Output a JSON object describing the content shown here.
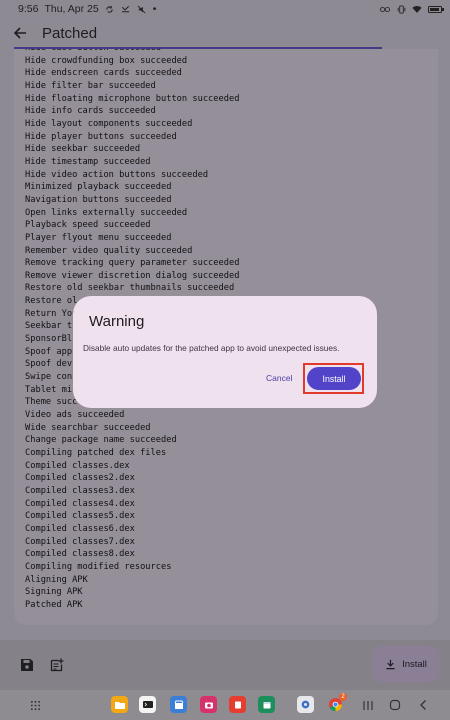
{
  "status_bar": {
    "time": "9:56",
    "date": "Thu, Apr 25",
    "dot": "•"
  },
  "app_bar": {
    "title": "Patched"
  },
  "log": {
    "lines": [
      "Hide cast button succeeded",
      "Hide crowdfunding box succeeded",
      "Hide endscreen cards succeeded",
      "Hide filter bar succeeded",
      "Hide floating microphone button succeeded",
      "Hide info cards succeeded",
      "Hide layout components succeeded",
      "Hide player buttons succeeded",
      "Hide seekbar succeeded",
      "Hide timestamp succeeded",
      "Hide video action buttons succeeded",
      "Minimized playback succeeded",
      "Navigation buttons succeeded",
      "Open links externally succeeded",
      "Playback speed succeeded",
      "Player flyout menu succeeded",
      "Remember video quality succeeded",
      "Remove tracking query parameter succeeded",
      "Remove viewer discretion dialog succeeded",
      "Restore old seekbar thumbnails succeeded",
      "Restore ol",
      "Return You",
      "Seekbar t",
      "SponsorBl",
      "Spoof app",
      "Spoof dev",
      "Swipe con",
      "Tablet mi",
      "Theme succ",
      "Video ads succeeded",
      "Wide searchbar succeeded",
      "Change package name succeeded",
      "Compiling patched dex files",
      "Compiled classes.dex",
      "Compiled classes2.dex",
      "Compiled classes3.dex",
      "Compiled classes4.dex",
      "Compiled classes5.dex",
      "Compiled classes6.dex",
      "Compiled classes7.dex",
      "Compiled classes8.dex",
      "Compiling modified resources",
      "Aligning APK",
      "Signing APK",
      "Patched APK"
    ]
  },
  "bottom_bar": {
    "install_label": "Install"
  },
  "taskbar": {
    "chrome_badge": "2"
  },
  "dialog": {
    "title": "Warning",
    "message": "Disable auto updates for the patched app to avoid unexpected issues.",
    "cancel_label": "Cancel",
    "confirm_label": "Install"
  },
  "colors": {
    "accent": "#5144c8",
    "highlight_outline": "#e03a2b",
    "dialog_surface": "#f0e1ef"
  }
}
